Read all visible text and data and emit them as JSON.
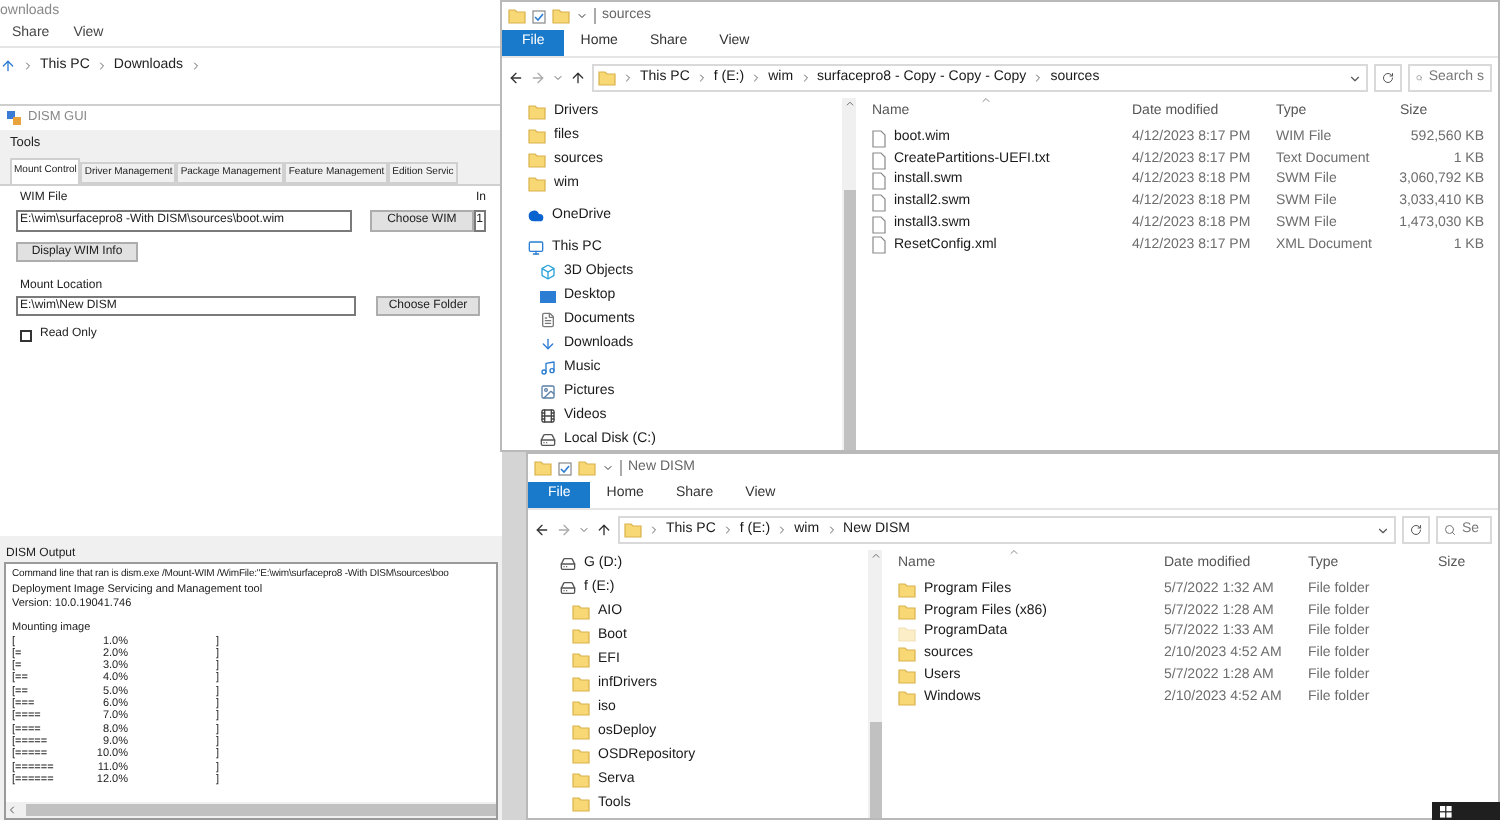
{
  "downloads_window": {
    "title": "ownloads",
    "menu": [
      "Share",
      "View"
    ],
    "breadcrumb": [
      "This PC",
      "Downloads"
    ]
  },
  "dism_gui": {
    "title": "DISM GUI",
    "menu": [
      "Tools"
    ],
    "tabs": [
      {
        "label": "Mount Control",
        "selected": true
      },
      {
        "label": "Driver Management",
        "selected": false
      },
      {
        "label": "Package Management",
        "selected": false
      },
      {
        "label": "Feature Management",
        "selected": false
      },
      {
        "label": "Edition Servic",
        "selected": false
      }
    ],
    "wim_file": {
      "label": "WIM File",
      "value": "E:\\wim\\surfacepro8 -With DISM\\sources\\boot.wim"
    },
    "choose_wim": "Choose WIM",
    "index": {
      "label": "In",
      "value": "1"
    },
    "display_info": "Display WIM Info",
    "mount_location": {
      "label": "Mount Location",
      "value": "E:\\wim\\New DISM"
    },
    "choose_folder": "Choose Folder",
    "read_only": {
      "label": "Read Only",
      "checked": false
    },
    "output": {
      "label": "DISM Output",
      "lines": [
        "Command line that ran is dism.exe /Mount-WIM /WimFile:\"E:\\wim\\surfacepro8 -With DISM\\sources\\boo",
        "Deployment Image Servicing and Management tool",
        "Version: 10.0.19041.746"
      ],
      "status": "Mounting image",
      "progress": [
        {
          "bar": "[",
          "percent": "1.0%",
          "end": "]"
        },
        {
          "bar": "[=",
          "percent": "2.0%",
          "end": "]"
        },
        {
          "bar": "[=",
          "percent": "3.0%",
          "end": "]"
        },
        {
          "bar": "[==",
          "percent": "4.0%",
          "end": "]"
        },
        {
          "bar": "[==",
          "percent": "5.0%",
          "end": "]"
        },
        {
          "bar": "[===",
          "percent": "6.0%",
          "end": "]"
        },
        {
          "bar": "[====",
          "percent": "7.0%",
          "end": "]"
        },
        {
          "bar": "[====",
          "percent": "8.0%",
          "end": "]"
        },
        {
          "bar": "[=====",
          "percent": "9.0%",
          "end": "]"
        },
        {
          "bar": "[=====",
          "percent": "10.0%",
          "end": "]"
        },
        {
          "bar": "[======",
          "percent": "11.0%",
          "end": "]"
        },
        {
          "bar": "[======",
          "percent": "12.0%",
          "end": "]"
        }
      ]
    }
  },
  "explorers": [
    {
      "title": "sources",
      "ribbon": [
        {
          "label": "File",
          "kind": "menu"
        },
        {
          "label": "Home",
          "kind": "tab"
        },
        {
          "label": "Share",
          "kind": "tab"
        },
        {
          "label": "View",
          "kind": "tab"
        }
      ],
      "breadcrumb": [
        "This PC",
        "f (E:)",
        "wim",
        "surfacepro8 - Copy - Copy - Copy",
        "sources"
      ],
      "search": {
        "placeholder": "Search s"
      },
      "nav": [
        {
          "label": "Drivers",
          "kind": "folder"
        },
        {
          "label": "files",
          "kind": "folder"
        },
        {
          "label": "sources",
          "kind": "folder"
        },
        {
          "label": "wim",
          "kind": "folder"
        },
        {
          "label": "OneDrive",
          "kind": "cloud"
        },
        {
          "label": "This PC",
          "kind": "computer",
          "children": [
            {
              "label": "3D Objects",
              "kind": "cube"
            },
            {
              "label": "Desktop",
              "kind": "desktop"
            },
            {
              "label": "Documents",
              "kind": "documents"
            },
            {
              "label": "Downloads",
              "kind": "download"
            },
            {
              "label": "Music",
              "kind": "music"
            },
            {
              "label": "Pictures",
              "kind": "pictures"
            },
            {
              "label": "Videos",
              "kind": "videos"
            },
            {
              "label": "Local Disk (C:)",
              "kind": "disk"
            }
          ]
        }
      ],
      "columns": [
        "Name",
        "Date modified",
        "Type",
        "Size"
      ],
      "rows": [
        {
          "name": "boot.wim",
          "date": "4/12/2023 8:17 PM",
          "type": "WIM File",
          "size": "592,560 KB",
          "kind": "file"
        },
        {
          "name": "CreatePartitions-UEFI.txt",
          "date": "4/12/2023 8:17 PM",
          "type": "Text Document",
          "size": "1 KB",
          "kind": "file"
        },
        {
          "name": "install.swm",
          "date": "4/12/2023 8:18 PM",
          "type": "SWM File",
          "size": "3,060,792 KB",
          "kind": "file"
        },
        {
          "name": "install2.swm",
          "date": "4/12/2023 8:18 PM",
          "type": "SWM File",
          "size": "3,033,410 KB",
          "kind": "file"
        },
        {
          "name": "install3.swm",
          "date": "4/12/2023 8:18 PM",
          "type": "SWM File",
          "size": "1,473,030 KB",
          "kind": "file"
        },
        {
          "name": "ResetConfig.xml",
          "date": "4/12/2023 8:17 PM",
          "type": "XML Document",
          "size": "1 KB",
          "kind": "file"
        }
      ]
    },
    {
      "title": "New DISM",
      "ribbon": [
        {
          "label": "File",
          "kind": "menu"
        },
        {
          "label": "Home",
          "kind": "tab"
        },
        {
          "label": "Share",
          "kind": "tab"
        },
        {
          "label": "View",
          "kind": "tab"
        }
      ],
      "breadcrumb": [
        "This PC",
        "f (E:)",
        "wim",
        "New DISM"
      ],
      "search": {
        "placeholder": "Se"
      },
      "nav": [
        {
          "label": "G (D:)",
          "kind": "drive"
        },
        {
          "label": "f (E:)",
          "kind": "drive",
          "children": [
            {
              "label": "AIO",
              "kind": "folder"
            },
            {
              "label": "Boot",
              "kind": "folder"
            },
            {
              "label": "EFI",
              "kind": "folder"
            },
            {
              "label": "infDrivers",
              "kind": "folder"
            },
            {
              "label": "iso",
              "kind": "folder"
            },
            {
              "label": "osDeploy",
              "kind": "folder"
            },
            {
              "label": "OSDRepository",
              "kind": "folder"
            },
            {
              "label": "Serva",
              "kind": "folder"
            },
            {
              "label": "Tools",
              "kind": "folder"
            }
          ]
        }
      ],
      "columns": [
        "Name",
        "Date modified",
        "Type",
        "Size"
      ],
      "rows": [
        {
          "name": "Program Files",
          "date": "5/7/2022 1:32 AM",
          "type": "File folder",
          "kind": "folder",
          "hidden": false
        },
        {
          "name": "Program Files (x86)",
          "date": "5/7/2022 1:28 AM",
          "type": "File folder",
          "kind": "folder",
          "hidden": false
        },
        {
          "name": "ProgramData",
          "date": "5/7/2022 1:33 AM",
          "type": "File folder",
          "kind": "folder",
          "hidden": true
        },
        {
          "name": "sources",
          "date": "2/10/2023 4:52 AM",
          "type": "File folder",
          "kind": "folder",
          "hidden": false
        },
        {
          "name": "Users",
          "date": "5/7/2022 1:28 AM",
          "type": "File folder",
          "kind": "folder",
          "hidden": false
        },
        {
          "name": "Windows",
          "date": "2/10/2023 4:52 AM",
          "type": "File folder",
          "kind": "folder",
          "hidden": false
        }
      ]
    }
  ]
}
